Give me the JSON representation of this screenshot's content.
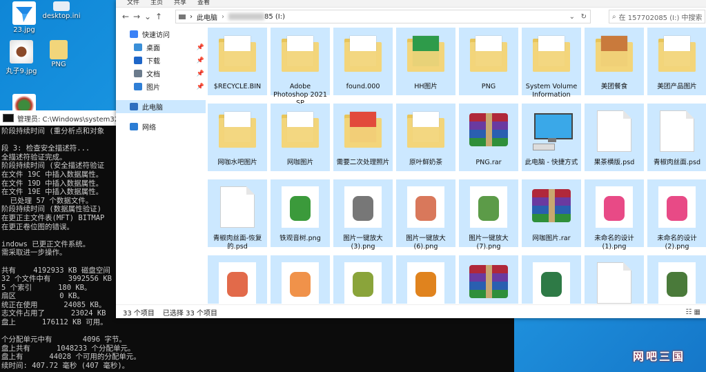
{
  "desktop": {
    "icons": [
      {
        "label": "desktop.ini",
        "icon": "settings-file-icon"
      },
      {
        "label": "PNG",
        "icon": "folder-icon"
      },
      {
        "label": "丸子9.jpg",
        "icon": "image-file-icon"
      },
      {
        "label": "23.jpg",
        "icon": "app-icon"
      }
    ],
    "watermark": "网吧三国"
  },
  "cmd": {
    "title": "管理员: C:\\Windows\\system32\\cm",
    "lines": [
      "阶段持续时间 (重分析点和对象",
      "",
      "段 3: 检查安全描述符...",
      "全描述符验证完成。",
      "阶段持续时间 (安全描述符验证",
      "在文件 19C 中插入数据属性。",
      "在文件 19D 中插入数据属性。",
      "在文件 19E 中插入数据属性。",
      "  已处理 57 个数据文件。",
      "阶段持续时间 (数据属性验证)",
      "在更正主文件表(MFT) BITMAP",
      "在更正卷位图的错误。",
      "",
      "indows 已更正文件系统。",
      "需采取进一步操作。",
      "",
      "共有    4192933 KB 磁盘空间",
      "32 个文件中有    3992556 KB",
      "5 个索引      180 KB。",
      "扇区          0 KB。",
      "统正在使用      24085 KB。",
      "志文件占用了      23024 KB",
      "盘上      176112 KB 可用。",
      "",
      "个分配单元中有       4096 字节。",
      "盘上共有      1048233 个分配单元。",
      "盘上有      44028 个可用的分配单元。",
      "续时间: 407.72 毫秒 (407 毫秒)。"
    ]
  },
  "explorer": {
    "menu": [
      "文件",
      "主页",
      "共享",
      "查看"
    ],
    "address": {
      "pc": "此电脑",
      "drive_suffix": "85 (I:)"
    },
    "search_placeholder": "在 157702085 (I:) 中搜索",
    "nav": [
      {
        "label": "快速访问",
        "icon": "star-icon"
      },
      {
        "label": "桌面",
        "icon": "desktop-icon"
      },
      {
        "label": "下载",
        "icon": "download-icon"
      },
      {
        "label": "文档",
        "icon": "document-icon"
      },
      {
        "label": "图片",
        "icon": "picture-icon"
      },
      {
        "label": "此电脑",
        "icon": "computer-icon"
      },
      {
        "label": "网络",
        "icon": "network-icon"
      }
    ],
    "items": [
      {
        "name": "$RECYCLE.BIN",
        "type": "folder"
      },
      {
        "name": "Adobe Photoshop 2021 SP",
        "type": "folder"
      },
      {
        "name": "found.000",
        "type": "folder"
      },
      {
        "name": "HH图片",
        "type": "folder"
      },
      {
        "name": "PNG",
        "type": "folder"
      },
      {
        "name": "System Volume Information",
        "type": "folder"
      },
      {
        "name": "美团餐食",
        "type": "folder"
      },
      {
        "name": "美团产品图片",
        "type": "folder"
      },
      {
        "name": "网咖水吧图片",
        "type": "folder"
      },
      {
        "name": "网咖图片",
        "type": "folder"
      },
      {
        "name": "需要二次处理照片",
        "type": "folder"
      },
      {
        "name": "原叶鲜奶茶",
        "type": "folder"
      },
      {
        "name": "PNG.rar",
        "type": "rar"
      },
      {
        "name": "此电脑 - 快捷方式",
        "type": "shortcut"
      },
      {
        "name": "果茶横版.psd",
        "type": "doc"
      },
      {
        "name": "青椒肉丝面.psd",
        "type": "doc"
      },
      {
        "name": "青椒肉丝面-恢复的.psd",
        "type": "doc"
      },
      {
        "name": "铁观音树.png",
        "type": "image"
      },
      {
        "name": "图片一键放大(3).png",
        "type": "image"
      },
      {
        "name": "图片一键放大(6).png",
        "type": "image"
      },
      {
        "name": "图片一键放大(7).png",
        "type": "image"
      },
      {
        "name": "网咖图片.rar",
        "type": "rar"
      },
      {
        "name": "未命名的设计(1).png",
        "type": "image"
      },
      {
        "name": "未命名的设计(2).png",
        "type": "image"
      },
      {
        "name": "",
        "type": "image"
      },
      {
        "name": "",
        "type": "image"
      },
      {
        "name": "",
        "type": "image"
      },
      {
        "name": "",
        "type": "image"
      },
      {
        "name": "",
        "type": "rar"
      },
      {
        "name": "",
        "type": "image"
      },
      {
        "name": "",
        "type": "doc"
      },
      {
        "name": "",
        "type": "image"
      }
    ],
    "status": {
      "count": "33 个项目",
      "selected": "已选择 33 个项目"
    }
  }
}
